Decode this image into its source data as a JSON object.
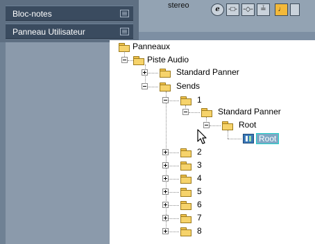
{
  "sidebar": {
    "items": [
      {
        "label": "Bloc-notes",
        "icon": "list-icon"
      },
      {
        "label": "Panneau Utilisateur",
        "icon": "panel-icon"
      }
    ]
  },
  "toolbar": {
    "mode_text": "stereo",
    "buttons": [
      {
        "label": "e",
        "icon": "edit-icon"
      },
      {
        "label": "-□-",
        "icon": "insert-icon"
      },
      {
        "label": "-◇-",
        "icon": "eq-icon"
      },
      {
        "label": "≟",
        "icon": "send-icon"
      },
      {
        "label": "♩",
        "icon": "note-icon"
      }
    ]
  },
  "tree": {
    "root": "Panneaux",
    "track": "Piste Audio",
    "standard_panner": "Standard Panner",
    "sends": "Sends",
    "send_items": [
      "1",
      "2",
      "3",
      "4",
      "5",
      "6",
      "7",
      "8"
    ],
    "send1_child": "Standard Panner",
    "send1_grandchild": "Root",
    "selected_leaf": "Root"
  },
  "colors": {
    "selection_bg": "#7fa7c4",
    "selection_border": "#1fd0c9",
    "folder": "#f6d36b"
  }
}
